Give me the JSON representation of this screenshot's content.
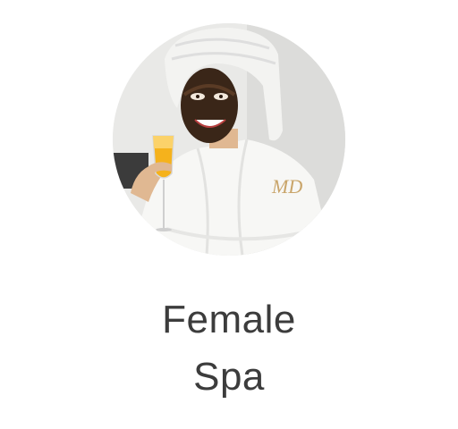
{
  "category": {
    "label_line1": "Female",
    "label_line2": "Spa",
    "monogram": "MD",
    "image_icon": "spa-woman-face-mask-photo"
  },
  "colors": {
    "background": "#ffffff",
    "label_text": "#3c3c3c",
    "image_background": "#ececec",
    "robe": "#f7f7f5",
    "mask": "#3a2618",
    "juice": "#f5b21c",
    "monogram_gold": "#c9a56a"
  }
}
